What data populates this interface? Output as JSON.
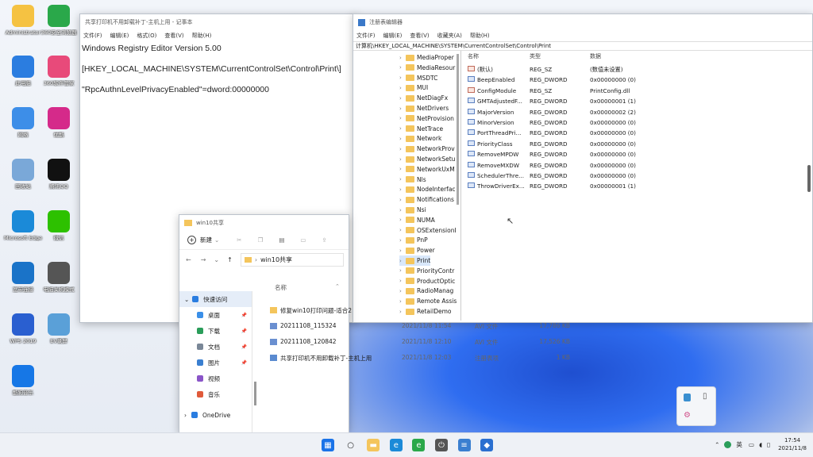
{
  "desktop_icons": [
    {
      "label": "Administrator",
      "color": "#f5c242",
      "icon": "folder-icon"
    },
    {
      "label": "360安全浏览器",
      "color": "#2aa84a",
      "icon": "browser-icon"
    },
    {
      "label": "此电脑",
      "color": "#2b7de0",
      "icon": "computer-icon"
    },
    {
      "label": "360软件管家",
      "color": "#e84a7a",
      "icon": "apps-icon"
    },
    {
      "label": "网络",
      "color": "#3d8ee8",
      "icon": "network-icon"
    },
    {
      "label": "优酷",
      "color": "#d52a8a",
      "icon": "video-icon"
    },
    {
      "label": "回收站",
      "color": "#7aa8d8",
      "icon": "recycle-bin-icon"
    },
    {
      "label": "腾讯QQ",
      "color": "#111111",
      "icon": "qq-icon"
    },
    {
      "label": "Microsoft Edge",
      "color": "#1b8ad8",
      "icon": "edge-icon"
    },
    {
      "label": "微信",
      "color": "#2dc100",
      "icon": "wechat-icon"
    },
    {
      "label": "宽带连接",
      "color": "#1a73c8",
      "icon": "broadband-icon"
    },
    {
      "label": "电脑关机模式",
      "color": "#555555",
      "icon": "power-icon"
    },
    {
      "label": "WPS 2019",
      "color": "#2a5fd0",
      "icon": "wps-icon"
    },
    {
      "label": "EV录屏",
      "color": "#5aa0d8",
      "icon": "recorder-icon"
    },
    {
      "label": "酷狗音乐",
      "color": "#1677e6",
      "icon": "music-icon"
    }
  ],
  "notepad": {
    "title": "共享打印机不用卸载补丁-主机上用 - 记事本",
    "menu": [
      "文件(F)",
      "编辑(E)",
      "格式(O)",
      "查看(V)",
      "帮助(H)"
    ],
    "lines": [
      "Windows Registry Editor Version 5.00",
      "[HKEY_LOCAL_MACHINE\\SYSTEM\\CurrentControlSet\\Control\\Print\\]",
      "\"RpcAuthnLevelPrivacyEnabled\"=dword:00000000"
    ]
  },
  "regedit": {
    "title": "注册表编辑器",
    "menu": [
      "文件(F)",
      "编辑(E)",
      "查看(V)",
      "收藏夹(A)",
      "帮助(H)"
    ],
    "address": "计算机\\HKEY_LOCAL_MACHINE\\SYSTEM\\CurrentControlSet\\Control\\Print",
    "tree": [
      "MediaProper",
      "MediaResour",
      "MSDTC",
      "MUI",
      "NetDiagFx",
      "NetDrivers",
      "NetProvision",
      "NetTrace",
      "Network",
      "NetworkProv",
      "NetworkSetu",
      "NetworkUxM",
      "Nls",
      "NodeInterfac",
      "Notifications",
      "Nsi",
      "NUMA",
      "OSExtensionI",
      "PnP",
      "Power",
      "Print",
      "PriorityContr",
      "ProductOptic",
      "RadioManag",
      "Remote Assis",
      "RetailDemo"
    ],
    "selected_index": 20,
    "headers": {
      "name": "名称",
      "type": "类型",
      "data": "数据"
    },
    "values": [
      {
        "name": "(默认)",
        "type": "REG_SZ",
        "data": "(数值未设置)",
        "kind": "sz"
      },
      {
        "name": "BeepEnabled",
        "type": "REG_DWORD",
        "data": "0x00000000 (0)",
        "kind": "dw"
      },
      {
        "name": "ConfigModule",
        "type": "REG_SZ",
        "data": "PrintConfig.dll",
        "kind": "sz"
      },
      {
        "name": "GMTAdjustedF...",
        "type": "REG_DWORD",
        "data": "0x00000001 (1)",
        "kind": "dw"
      },
      {
        "name": "MajorVersion",
        "type": "REG_DWORD",
        "data": "0x00000002 (2)",
        "kind": "dw"
      },
      {
        "name": "MinorVersion",
        "type": "REG_DWORD",
        "data": "0x00000000 (0)",
        "kind": "dw"
      },
      {
        "name": "PortThreadPri...",
        "type": "REG_DWORD",
        "data": "0x00000000 (0)",
        "kind": "dw"
      },
      {
        "name": "PriorityClass",
        "type": "REG_DWORD",
        "data": "0x00000000 (0)",
        "kind": "dw"
      },
      {
        "name": "RemoveMPDW",
        "type": "REG_DWORD",
        "data": "0x00000000 (0)",
        "kind": "dw"
      },
      {
        "name": "RemoveMXDW",
        "type": "REG_DWORD",
        "data": "0x00000000 (0)",
        "kind": "dw"
      },
      {
        "name": "SchedulerThre...",
        "type": "REG_DWORD",
        "data": "0x00000000 (0)",
        "kind": "dw"
      },
      {
        "name": "ThrowDriverEx...",
        "type": "REG_DWORD",
        "data": "0x00000001 (1)",
        "kind": "dw"
      }
    ]
  },
  "explorer": {
    "title": "win10共享",
    "new_label": "新建",
    "path": "win10共享",
    "col_name": "名称",
    "sidebar": [
      {
        "label": "快速访问",
        "color": "#2a7de0"
      },
      {
        "label": "桌面",
        "color": "#3a8fe8"
      },
      {
        "label": "下载",
        "color": "#2a9d5a"
      },
      {
        "label": "文档",
        "color": "#7a8797"
      },
      {
        "label": "图片",
        "color": "#3a7fd0"
      },
      {
        "label": "视频",
        "color": "#8a55c8"
      },
      {
        "label": "音乐",
        "color": "#e05a3a"
      }
    ],
    "onedrive": "OneDrive",
    "files": [
      {
        "name": "修复win10打印问题-适合2",
        "date": "",
        "type": "",
        "size": "",
        "kind": "folder"
      },
      {
        "name": "20211108_115324",
        "date": "2021/11/8 11:54",
        "type": "AVI 文件",
        "size": "17,786 KB",
        "kind": "video"
      },
      {
        "name": "20211108_120842",
        "date": "2021/11/8 12:10",
        "type": "AVI 文件",
        "size": "17,526 KB",
        "kind": "video"
      },
      {
        "name": "共享打印机不用卸载补丁-主机上用",
        "date": "2021/11/8 12:03",
        "type": "注册表项",
        "size": "1 KB",
        "kind": "reg"
      }
    ]
  },
  "taskbar": {
    "icons": [
      "windows-start-icon",
      "search-icon",
      "file-explorer-icon",
      "edge-icon",
      "360-browser-icon",
      "power-tool-icon",
      "notepad-icon",
      "regedit-icon"
    ],
    "tray_lang": "英",
    "time": "17:54",
    "date": "2021/11/8"
  }
}
